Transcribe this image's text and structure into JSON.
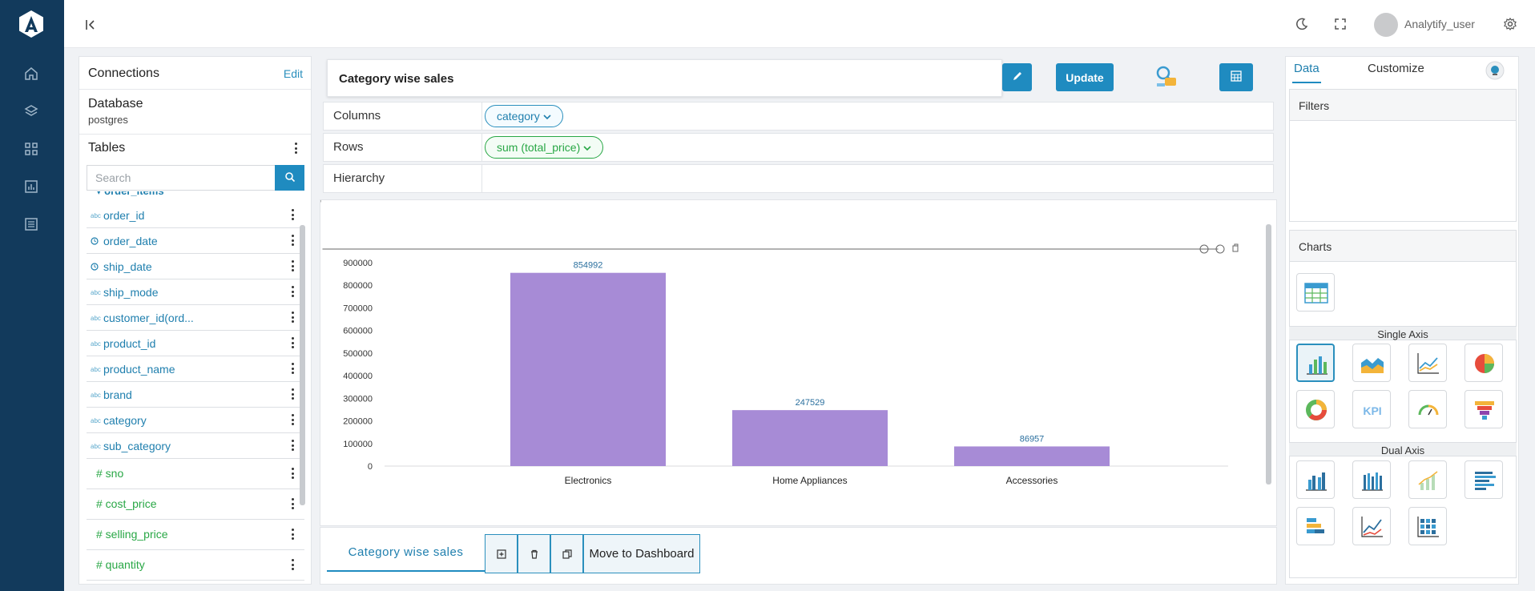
{
  "header": {
    "username": "Analytify_user"
  },
  "connections": {
    "title": "Connections",
    "edit_label": "Edit",
    "database_title": "Database",
    "database_name": "postgres",
    "tables_title": "Tables",
    "search_placeholder": "Search",
    "cut_field": "▾ order_items",
    "fields": [
      {
        "type": "abc",
        "name": "order_id"
      },
      {
        "type": "date",
        "name": "order_date"
      },
      {
        "type": "date",
        "name": "ship_date"
      },
      {
        "type": "abc",
        "name": "ship_mode"
      },
      {
        "type": "abc",
        "name": "customer_id(ord..."
      },
      {
        "type": "abc",
        "name": "product_id"
      },
      {
        "type": "abc",
        "name": "product_name"
      },
      {
        "type": "abc",
        "name": "brand"
      },
      {
        "type": "abc",
        "name": "category"
      },
      {
        "type": "abc",
        "name": "sub_category"
      },
      {
        "type": "num",
        "name": "# sno"
      },
      {
        "type": "num",
        "name": "# cost_price"
      },
      {
        "type": "num",
        "name": "# selling_price"
      },
      {
        "type": "num",
        "name": "# quantity"
      }
    ]
  },
  "sheet": {
    "title": "Category wise sales",
    "update_label": "Update",
    "shelves": {
      "columns_label": "Columns",
      "columns_pill": "category",
      "rows_label": "Rows",
      "rows_pill": "sum (total_price)",
      "hierarchy_label": "Hierarchy"
    },
    "tab_label": "Category wise sales",
    "move_label": "Move to Dashboard"
  },
  "right_panel": {
    "tab_data": "Data",
    "tab_customize": "Customize",
    "filters_title": "Filters",
    "charts_title": "Charts",
    "single_axis_label": "Single Axis",
    "dual_axis_label": "Dual Axis"
  },
  "colors": {
    "nav": "#123a5c",
    "accent": "#1f8bc0",
    "bar": "#a78bd6"
  },
  "chart_data": {
    "type": "bar",
    "categories": [
      "Electronics",
      "Home Appliances",
      "Accessories"
    ],
    "values": [
      854992,
      247529,
      86957
    ],
    "yticks": [
      "900000",
      "800000",
      "700000",
      "600000",
      "500000",
      "400000",
      "300000",
      "200000",
      "100000",
      "0"
    ],
    "ylim": [
      0,
      900000
    ],
    "title": "",
    "xlabel": "",
    "ylabel": ""
  }
}
